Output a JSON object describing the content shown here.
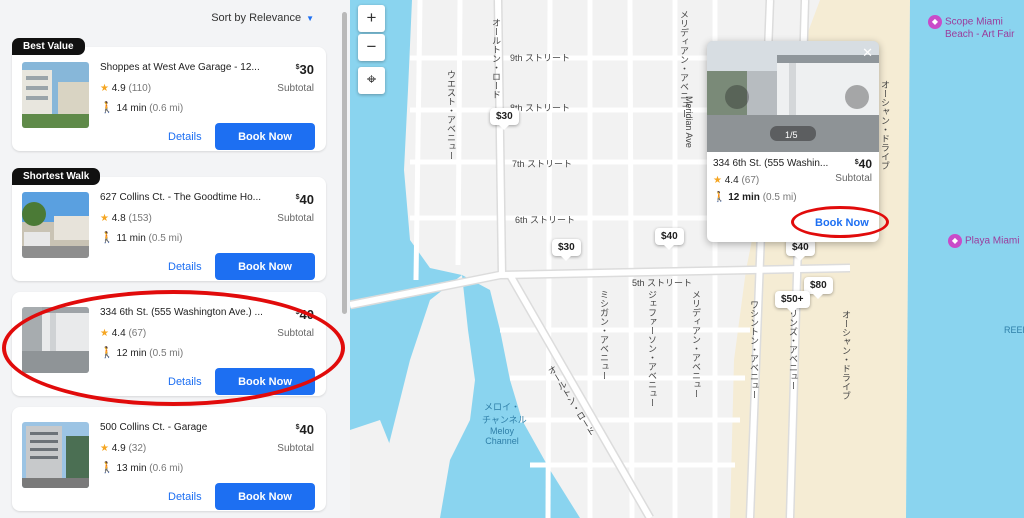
{
  "sort": {
    "label": "Sort by Relevance"
  },
  "listings": [
    {
      "tag": "Best Value",
      "title": "Shoppes at West Ave Garage - 12...",
      "rating": "4.9",
      "reviews": "(110)",
      "walk_min": "14 min",
      "walk_mi": "(0.6 mi)",
      "price": "30",
      "subtotal": "Subtotal",
      "details": "Details",
      "book": "Book Now"
    },
    {
      "tag": "Shortest Walk",
      "title": "627 Collins Ct. - The Goodtime Ho...",
      "rating": "4.8",
      "reviews": "(153)",
      "walk_min": "11 min",
      "walk_mi": "(0.5 mi)",
      "price": "40",
      "subtotal": "Subtotal",
      "details": "Details",
      "book": "Book Now"
    },
    {
      "tag": "",
      "title": "334 6th St. (555 Washington Ave.) ...",
      "rating": "4.4",
      "reviews": "(67)",
      "walk_min": "12 min",
      "walk_mi": "(0.5 mi)",
      "price": "40",
      "subtotal": "Subtotal",
      "details": "Details",
      "book": "Book Now"
    },
    {
      "tag": "",
      "title": "500 Collins Ct. - Garage",
      "rating": "4.9",
      "reviews": "(32)",
      "walk_min": "13 min",
      "walk_mi": "(0.6 mi)",
      "price": "40",
      "subtotal": "Subtotal",
      "details": "Details",
      "book": "Book Now"
    }
  ],
  "currency": "$",
  "star": "★",
  "walk_icon": "🚶",
  "map": {
    "zoom_in": "+",
    "zoom_out": "−",
    "locate": "⌖",
    "pins": [
      "$30",
      "$30",
      "$40",
      "$40",
      "$80",
      "$50+"
    ],
    "streets": {
      "s9": "9th ストリート",
      "s8": "8th ストリート",
      "s7": "7th ストリート",
      "s6": "6th ストリート",
      "s5": "5th ストリート",
      "alton1": "オールトン・ロード",
      "alton2": "オールトン・ロード",
      "west": "ウエスト・アベニュー",
      "meridian1": "メリディアン・アベニュー",
      "meridian_en": "Meridian Ave",
      "meridian2": "メリディアン・アベニュー",
      "michigan": "ミシガン・アベニュー",
      "jefferson": "ジェファーソン・アベニュー",
      "washington": "ワシントン・アベニュー",
      "collins": "コリンズ・アベニュー",
      "ocean1": "オーシャン・ドライブ",
      "ocean2": "オーシャン・ドライブ",
      "canal_jp": "メロイ・",
      "canal_jp2": "チャンネル",
      "canal_en": "Meloy",
      "canal_en2": "Channel",
      "reef": "REEF"
    },
    "pois": {
      "scope1": "Scope Miami",
      "scope2": "Beach - Art Fair",
      "playa": "Playa Miami"
    }
  },
  "popup": {
    "close": "✕",
    "counter": "1/5",
    "title": "334 6th St. (555 Washin...",
    "price": "40",
    "subtotal": "Subtotal",
    "rating": "4.4",
    "reviews": "(67)",
    "walk_min": "12 min",
    "walk_mi": "(0.5 mi)",
    "book": "Book Now"
  },
  "colors": {
    "accent": "#1d6ff2",
    "annotation": "#e10b0b",
    "water": "#8ad4ef",
    "beach": "#f5ecd4"
  }
}
